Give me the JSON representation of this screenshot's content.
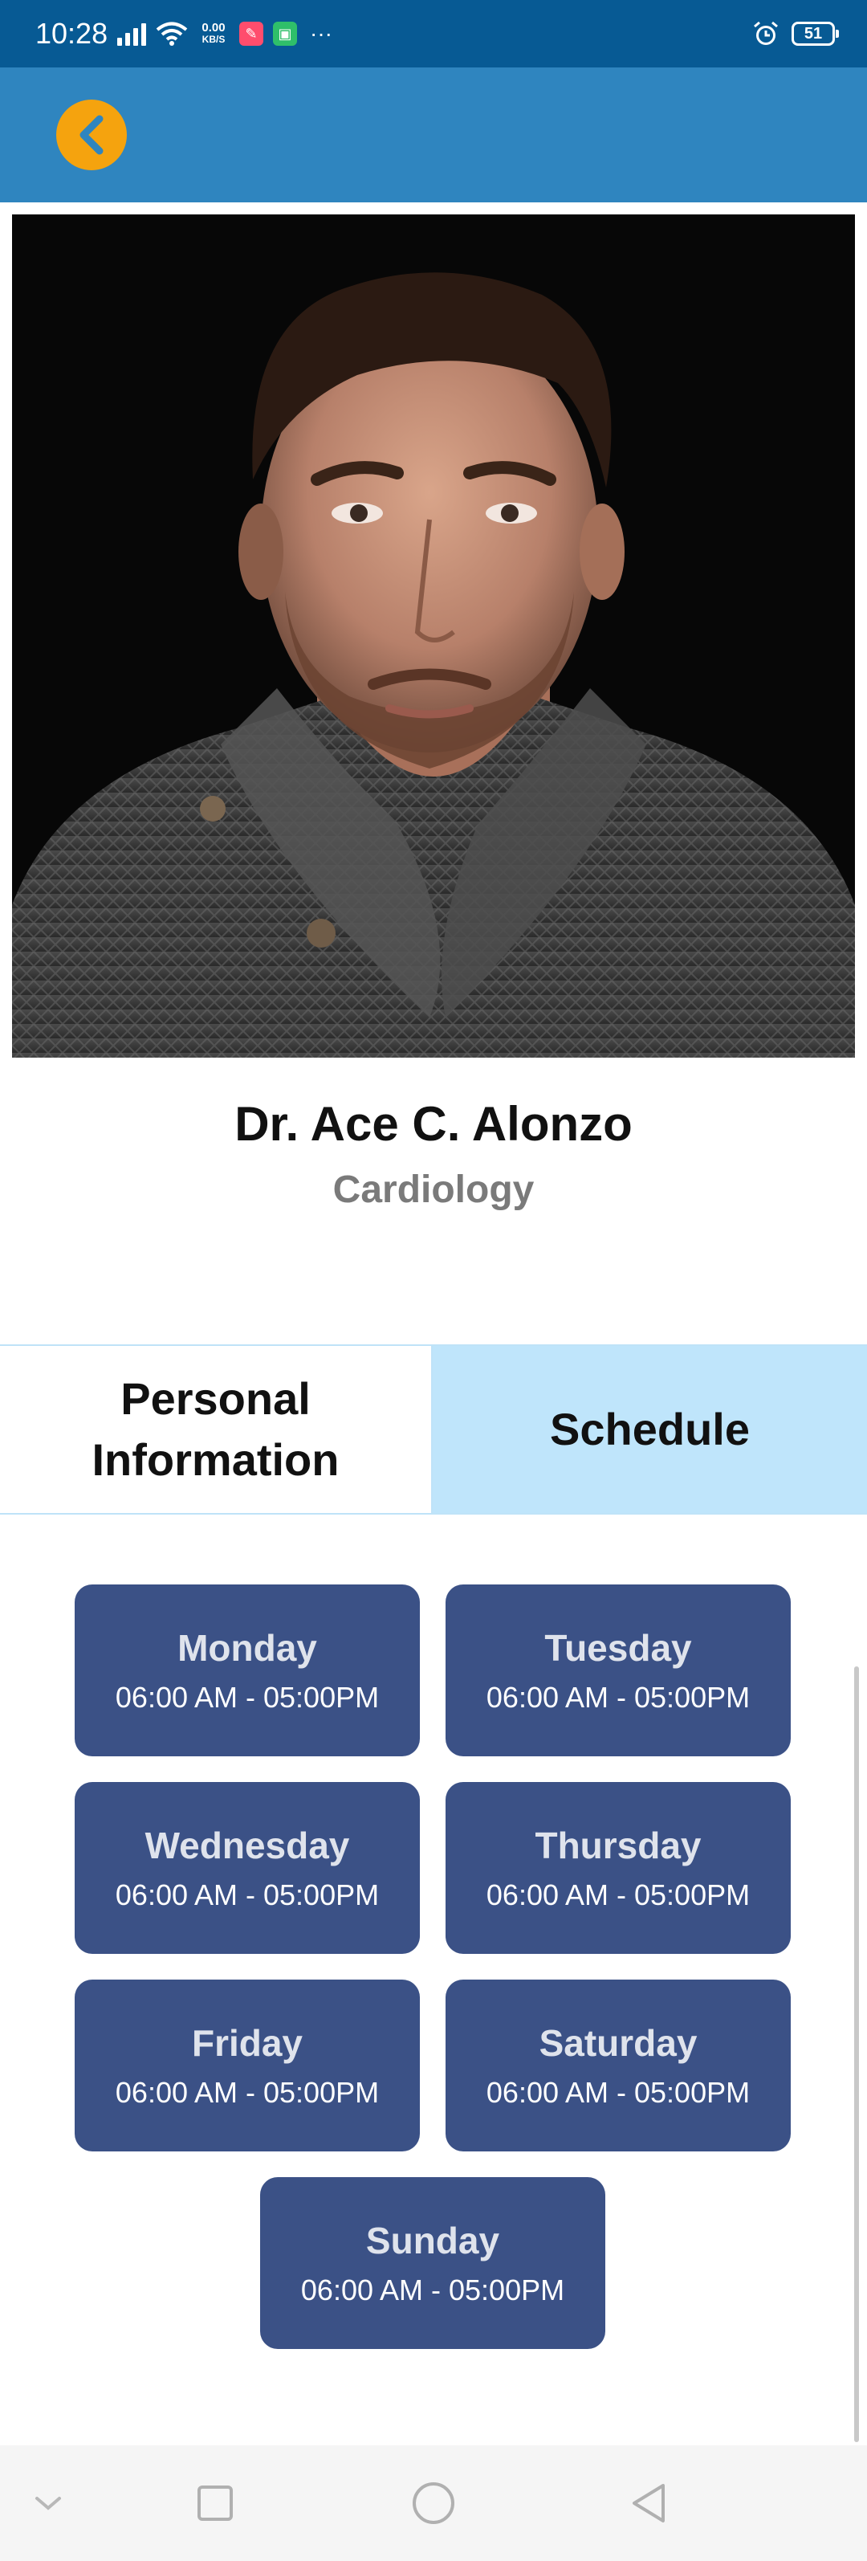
{
  "status_bar": {
    "time": "10:28",
    "net_speed_value": "0.00",
    "net_speed_unit": "KB/S",
    "battery": "51",
    "icons": [
      "signal-icon",
      "wifi-icon",
      "app-notification-icon",
      "app-notification-icon",
      "more-icon",
      "alarm-icon",
      "battery-icon"
    ]
  },
  "header": {
    "back_icon": "chevron-left-icon",
    "accent": "#f5a30e",
    "bar_color": "#2f85bf"
  },
  "doctor": {
    "name": "Dr. Ace C. Alonzo",
    "department": "Cardiology"
  },
  "tabs": [
    {
      "label": "Personal Information",
      "active": false
    },
    {
      "label": "Schedule",
      "active": true
    }
  ],
  "schedule": [
    {
      "day": "Monday",
      "hours": "06:00 AM - 05:00PM"
    },
    {
      "day": "Tuesday",
      "hours": "06:00 AM - 05:00PM"
    },
    {
      "day": "Wednesday",
      "hours": "06:00 AM - 05:00PM"
    },
    {
      "day": "Thursday",
      "hours": "06:00 AM - 05:00PM"
    },
    {
      "day": "Friday",
      "hours": "06:00 AM - 05:00PM"
    },
    {
      "day": "Saturday",
      "hours": "06:00 AM - 05:00PM"
    },
    {
      "day": "Sunday",
      "hours": "06:00 AM - 05:00PM"
    }
  ],
  "colors": {
    "card": "#3b5186",
    "active_tab": "#bfe5fb",
    "status_bar": "#075a94"
  },
  "nav": [
    "chevron-down-icon",
    "square-icon",
    "circle-icon",
    "triangle-back-icon"
  ]
}
